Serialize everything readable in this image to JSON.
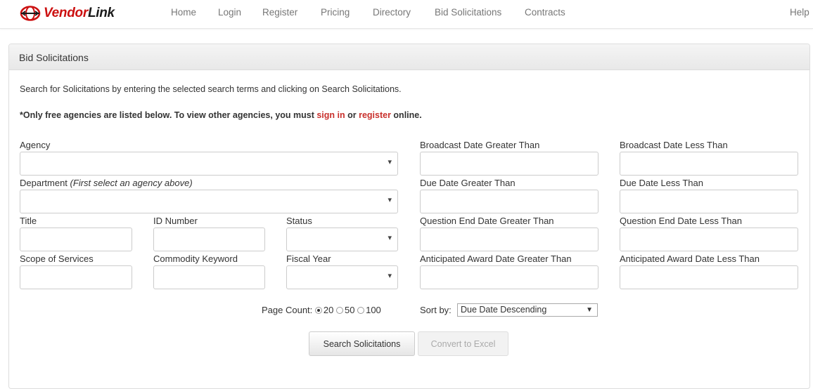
{
  "brand": {
    "logo_text_red": "Vendor",
    "logo_text_dark": "Link",
    "accent_color": "#cc1111"
  },
  "nav": {
    "items": [
      "Home",
      "Login",
      "Register",
      "Pricing",
      "Directory",
      "Bid Solicitations",
      "Contracts"
    ],
    "help": "Help"
  },
  "panel": {
    "title": "Bid Solicitations",
    "intro": "Search for Solicitations by entering the selected search terms and clicking on Search Solicitations.",
    "notice_pre": "*Only free agencies are listed below. To view other agencies, you must ",
    "sign_in": "sign in",
    "or": " or ",
    "register": "register",
    "notice_post": " online."
  },
  "form": {
    "agency": "Agency",
    "department": "Department",
    "department_hint": "(First select an agency above)",
    "title": "Title",
    "id_number": "ID Number",
    "status": "Status",
    "scope": "Scope of Services",
    "commodity": "Commodity Keyword",
    "fiscal_year": "Fiscal Year",
    "broadcast_gt": "Broadcast Date Greater Than",
    "broadcast_lt": "Broadcast Date Less Than",
    "due_gt": "Due Date Greater Than",
    "due_lt": "Due Date Less Than",
    "question_gt": "Question End Date Greater Than",
    "question_lt": "Question End Date Less Than",
    "award_gt": "Anticipated Award Date Greater Than",
    "award_lt": "Anticipated Award Date Less Than"
  },
  "options": {
    "page_count_label": "Page Count:",
    "page_counts": [
      "20",
      "50",
      "100"
    ],
    "page_count_selected": "20",
    "sort_label": "Sort by:",
    "sort_value": "Due Date Descending"
  },
  "buttons": {
    "search": "Search Solicitations",
    "excel": "Convert to Excel"
  }
}
